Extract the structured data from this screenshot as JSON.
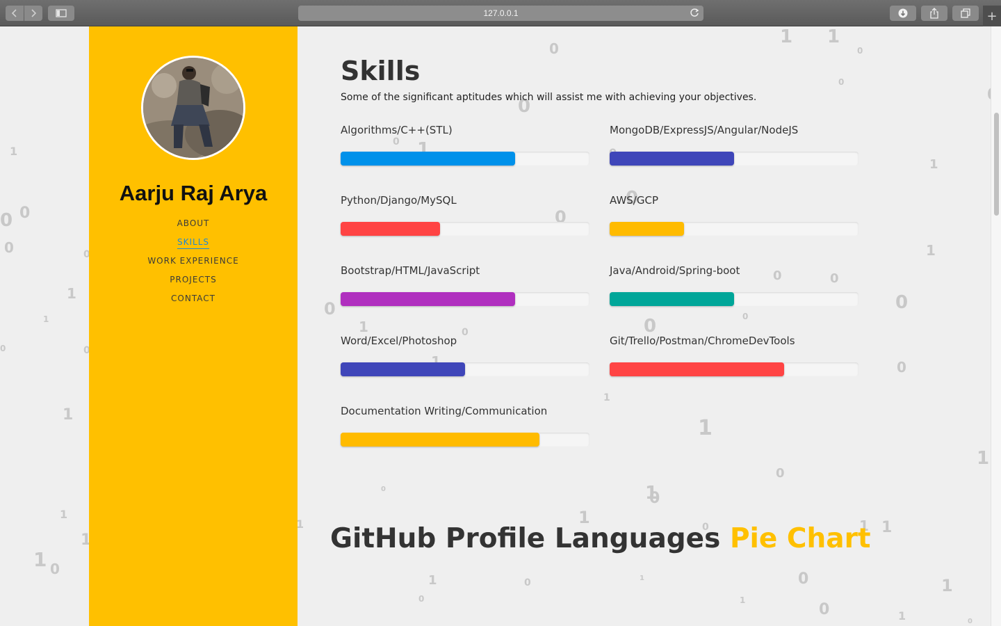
{
  "browser": {
    "url": "127.0.0.1",
    "new_tab_symbol": "+"
  },
  "sidebar": {
    "name": "Aarju Raj Arya",
    "nav": [
      {
        "label": "ABOUT",
        "active": false
      },
      {
        "label": "SKILLS",
        "active": true
      },
      {
        "label": "WORK EXPERIENCE",
        "active": false
      },
      {
        "label": "PROJECTS",
        "active": false
      },
      {
        "label": "CONTACT",
        "active": false
      }
    ]
  },
  "skills": {
    "title": "Skills",
    "subtitle": "Some of the significant aptitudes which will assist me with achieving your objectives.",
    "items": [
      {
        "label": "Algorithms/C++(STL)",
        "level": 0.7,
        "color": "#0091ea"
      },
      {
        "label": "MongoDB/ExpressJS/Angular/NodeJS",
        "level": 0.5,
        "color": "#3f46b9"
      },
      {
        "label": "Python/Django/MySQL",
        "level": 0.4,
        "color": "#ff4444"
      },
      {
        "label": "AWS/GCP",
        "level": 0.3,
        "color": "#ffbb00"
      },
      {
        "label": "Bootstrap/HTML/JavaScript",
        "level": 0.7,
        "color": "#b02fbf"
      },
      {
        "label": "Java/Android/Spring-boot",
        "level": 0.5,
        "color": "#00a699"
      },
      {
        "label": "Word/Excel/Photoshop",
        "level": 0.5,
        "color": "#3f46b9"
      },
      {
        "label": "Git/Trello/Postman/ChromeDevTools",
        "level": 0.7,
        "color": "#ff4444"
      },
      {
        "label": "Documentation Writing/Communication",
        "level": 0.8,
        "color": "#ffbb00"
      }
    ]
  },
  "pie_section": {
    "title_main": "GitHub Profile Languages ",
    "title_accent": "Pie Chart"
  },
  "background_digits": [
    "0",
    "1"
  ]
}
